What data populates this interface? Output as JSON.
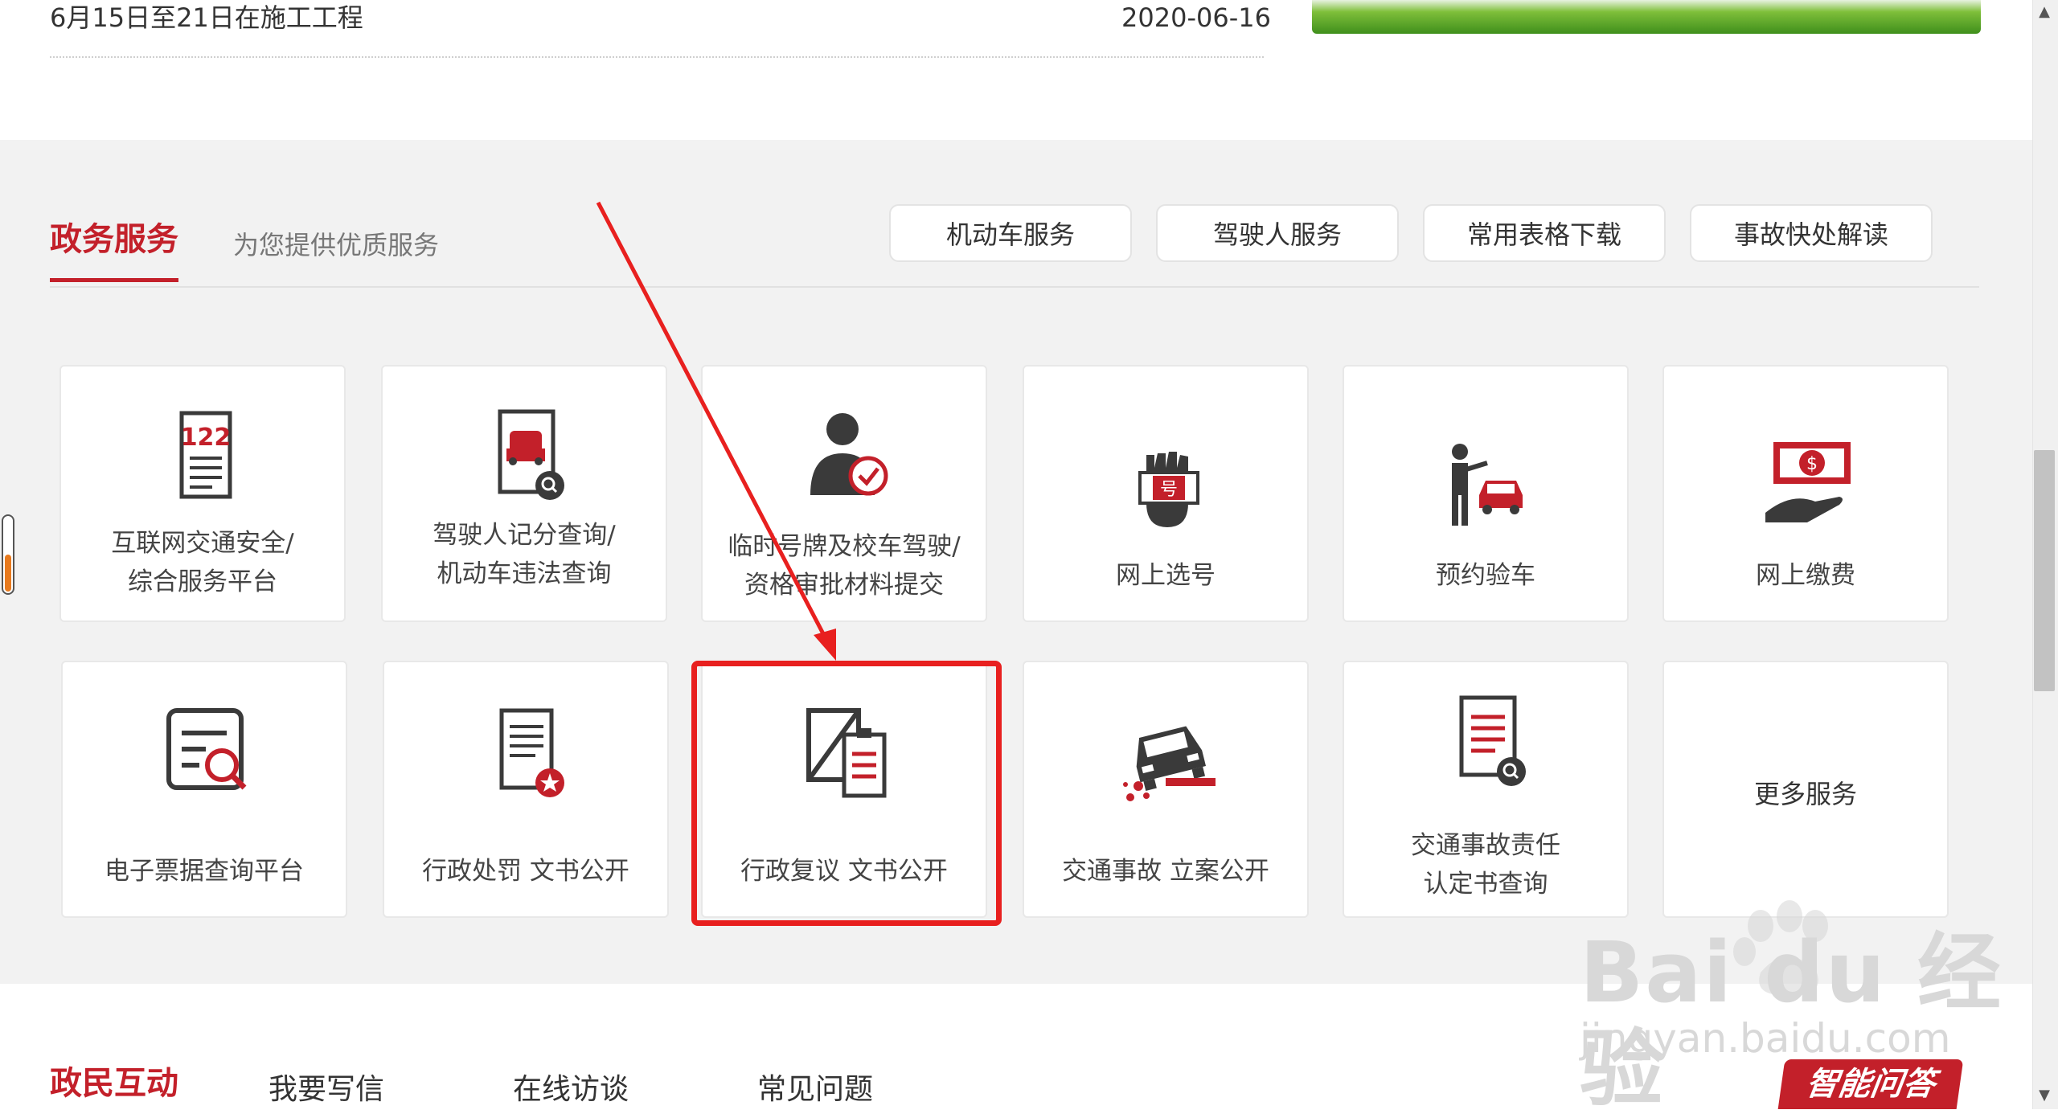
{
  "news": {
    "title": "6月15日至21日在施工工程",
    "date": "2020-06-16"
  },
  "services": {
    "heading": "政务服务",
    "subtitle": "为您提供优质服务",
    "tabs": [
      {
        "label": "机动车服务"
      },
      {
        "label": "驾驶人服务"
      },
      {
        "label": "常用表格下载"
      },
      {
        "label": "事故快处解读"
      }
    ],
    "cards": [
      {
        "line1": "互联网交通安全/",
        "line2": "综合服务平台",
        "icon": "122-document-icon"
      },
      {
        "line1": "驾驶人记分查询/",
        "line2": "机动车违法查询",
        "icon": "car-search-icon"
      },
      {
        "line1": "临时号牌及校车驾驶/",
        "line2": "资格审批材料提交",
        "icon": "user-check-icon"
      },
      {
        "line1": "网上选号",
        "line2": "",
        "icon": "hand-plate-icon"
      },
      {
        "line1": "预约验车",
        "line2": "",
        "icon": "person-car-icon"
      },
      {
        "line1": "网上缴费",
        "line2": "",
        "icon": "hand-money-icon"
      },
      {
        "line1": "电子票据查询平台",
        "line2": "",
        "icon": "receipt-search-icon"
      },
      {
        "line1": "行政处罚 文书公开",
        "line2": "",
        "icon": "document-stamp-icon"
      },
      {
        "line1": "行政复议 文书公开",
        "line2": "",
        "icon": "review-clipboard-icon"
      },
      {
        "line1": "交通事故 立案公开",
        "line2": "",
        "icon": "crash-car-icon"
      },
      {
        "line1": "交通事故责任",
        "line2": "认定书查询",
        "icon": "document-search-icon"
      },
      {
        "line1": "更多服务",
        "line2": "",
        "icon": ""
      }
    ]
  },
  "interaction": {
    "heading": "政民互动",
    "links": [
      {
        "label": "我要写信"
      },
      {
        "label": "在线访谈"
      },
      {
        "label": "常见问题"
      }
    ],
    "smart_qa": "智能问答"
  },
  "watermark": {
    "main": "Bai du 经验",
    "sub": "jingyan.baidu.com"
  },
  "colors": {
    "brand_red": "#c3202a",
    "highlight_red": "#e8201f",
    "section_bg": "#f2f2f2"
  }
}
